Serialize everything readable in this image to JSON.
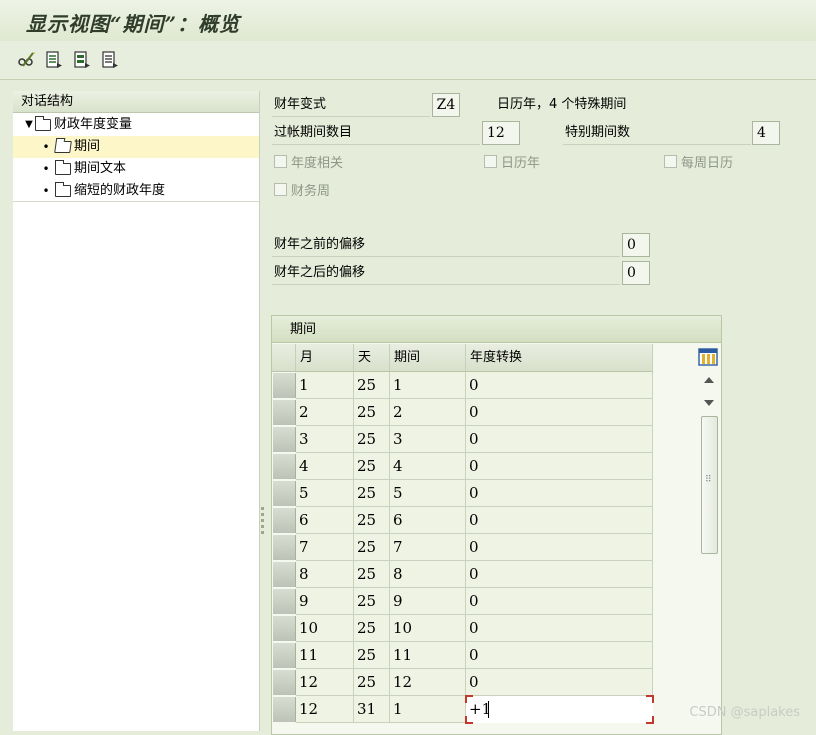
{
  "window": {
    "title": "显示视图“期间”：概览"
  },
  "toolbar": {
    "buttons": [
      {
        "icon": "pencil-glasses-icon"
      },
      {
        "icon": "document-icon"
      },
      {
        "icon": "document-next-icon"
      },
      {
        "icon": "document-list-icon"
      }
    ]
  },
  "tree": {
    "header": "对话结构",
    "items": [
      {
        "label": "财政年度变量",
        "level": 0,
        "expanded": true,
        "selected": false
      },
      {
        "label": "期间",
        "level": 1,
        "selected": true
      },
      {
        "label": "期间文本",
        "level": 1,
        "selected": false
      },
      {
        "label": "缩短的财政年度",
        "level": 1,
        "selected": false
      }
    ]
  },
  "form": {
    "variant_label": "财年变式",
    "variant_value": "Z4",
    "variant_desc": "日历年，4 个特殊期间",
    "posting_periods_label": "过帐期间数目",
    "posting_periods_value": "12",
    "special_periods_label": "特别期间数",
    "special_periods_value": "4",
    "chk_year_dependent": "年度相关",
    "chk_calendar_year": "日历年",
    "chk_weekly_calendar": "每周日历",
    "chk_fiscal_week": "财务周",
    "offset_before_label": "财年之前的偏移",
    "offset_before_value": "0",
    "offset_after_label": "财年之后的偏移",
    "offset_after_value": "0"
  },
  "table": {
    "title": "期间",
    "columns": [
      "月",
      "天",
      "期间",
      "年度转换"
    ],
    "rows": [
      [
        "1",
        "25",
        "1",
        "0"
      ],
      [
        "2",
        "25",
        "2",
        "0"
      ],
      [
        "3",
        "25",
        "3",
        "0"
      ],
      [
        "4",
        "25",
        "4",
        "0"
      ],
      [
        "5",
        "25",
        "5",
        "0"
      ],
      [
        "6",
        "25",
        "6",
        "0"
      ],
      [
        "7",
        "25",
        "7",
        "0"
      ],
      [
        "8",
        "25",
        "8",
        "0"
      ],
      [
        "9",
        "25",
        "9",
        "0"
      ],
      [
        "10",
        "25",
        "10",
        "0"
      ],
      [
        "11",
        "25",
        "11",
        "0"
      ],
      [
        "12",
        "25",
        "12",
        "0"
      ],
      [
        "12",
        "31",
        "1",
        "+1"
      ]
    ]
  },
  "watermark": "CSDN @saplakes",
  "colors": {
    "background": "#e5ecd9",
    "selected_tree": "#fdf6c8",
    "edit_corner": "#c0392b"
  }
}
